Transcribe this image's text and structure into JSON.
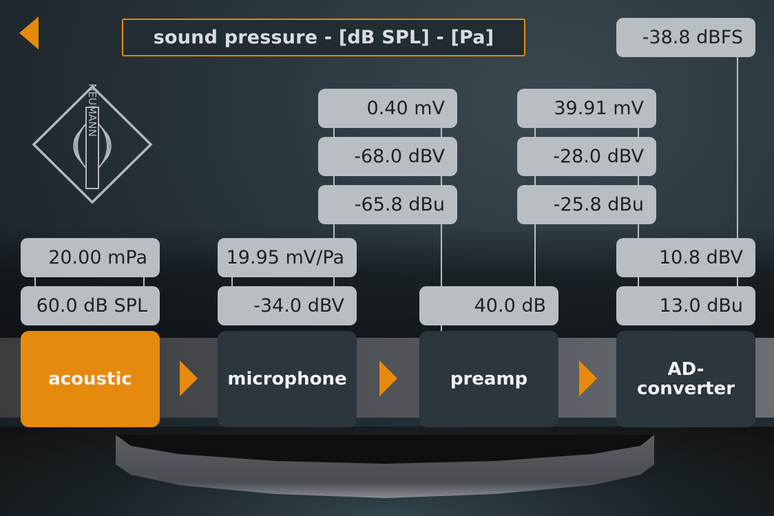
{
  "header": {
    "back_icon": "triangle-left-icon",
    "title": "sound pressure - [dB SPL] - [Pa]"
  },
  "brand": {
    "logo_text": "NEUMANN",
    "logo_icon": "neumann-diamond-logo"
  },
  "colors": {
    "accent": "#e68a0e",
    "stage_bg": "#2b363d",
    "value_box_bg": "#b9bec3",
    "value_text": "#1e2226"
  },
  "chain": {
    "stages": [
      {
        "label": "acoustic",
        "active": true
      },
      {
        "label": "microphone",
        "active": false
      },
      {
        "label": "preamp",
        "active": false
      },
      {
        "label": "AD-\nconverter",
        "label_line1": "AD-",
        "label_line2": "converter",
        "active": false
      }
    ],
    "arrow_icon": "triangle-right-icon"
  },
  "values": {
    "acoustic": {
      "pressure": "20.00 mPa",
      "spl": "60.0 dB SPL"
    },
    "microphone": {
      "sensitivity": "19.95 mV/Pa",
      "sensitivity_dbv": "-34.0 dBV",
      "output_mv": "0.40 mV",
      "output_dbv": "-68.0 dBV",
      "output_dbu": "-65.8 dBu"
    },
    "preamp": {
      "gain": "40.0 dB",
      "output_mv": "39.91 mV",
      "output_dbv": "-28.0 dBV",
      "output_dbu": "-25.8 dBu"
    },
    "ad_converter": {
      "dbfs": "-38.8 dBFS",
      "max_dbv": "10.8 dBV",
      "max_dbu": "13.0 dBu"
    }
  }
}
